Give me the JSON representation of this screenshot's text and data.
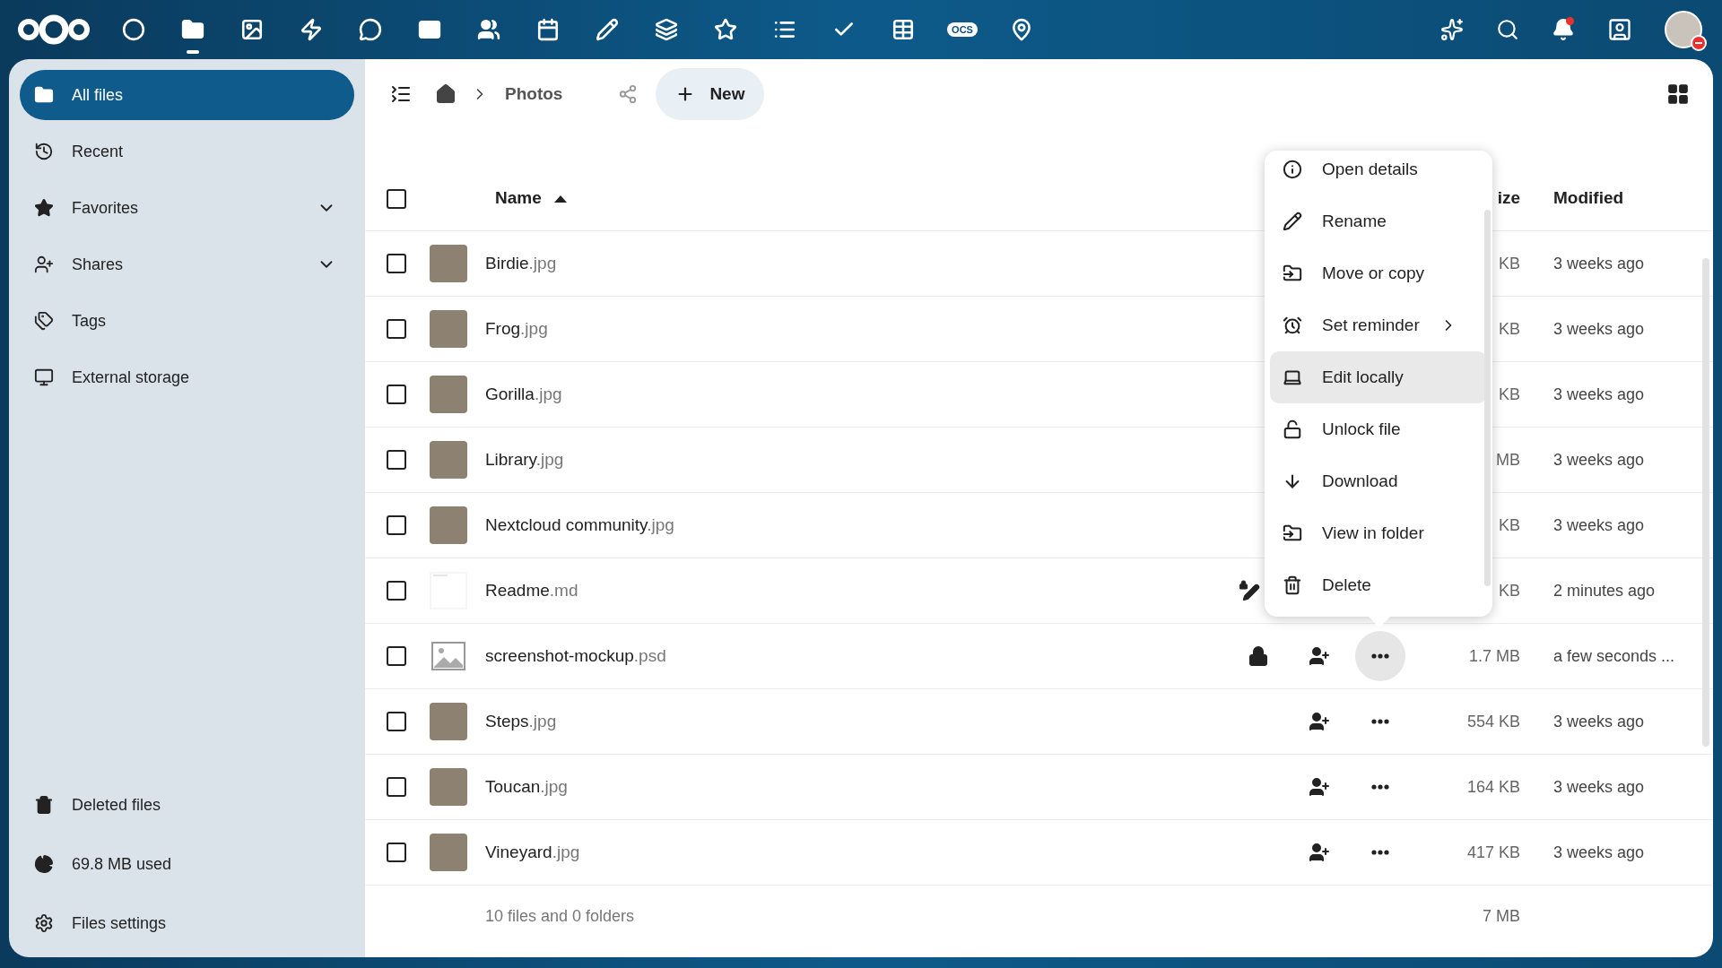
{
  "app_bar": {
    "apps": [
      {
        "selected": false
      },
      {
        "selected": true
      },
      {
        "selected": false
      },
      {
        "selected": false
      },
      {
        "selected": false
      },
      {
        "selected": false
      },
      {
        "selected": false
      },
      {
        "selected": false
      },
      {
        "selected": false
      },
      {
        "selected": false
      },
      {
        "selected": false
      },
      {
        "selected": false
      },
      {
        "selected": false
      },
      {
        "selected": false
      },
      {
        "selected": false,
        "label": "OCS"
      },
      {
        "selected": false
      }
    ],
    "notifications_unread": true,
    "do_not_disturb": true
  },
  "sidebar": {
    "nav": [
      {
        "label": "All files",
        "selected": true
      },
      {
        "label": "Recent",
        "selected": false
      },
      {
        "label": "Favorites",
        "selected": false,
        "expanded": false
      },
      {
        "label": "Shares",
        "selected": false,
        "expanded": false
      },
      {
        "label": "Tags",
        "selected": false
      },
      {
        "label": "External storage",
        "selected": false
      }
    ],
    "footer": [
      {
        "label": "Deleted files"
      },
      {
        "label": "69.8 MB used"
      },
      {
        "label": "Files settings"
      }
    ]
  },
  "toolbar": {
    "breadcrumb": [
      "Photos"
    ],
    "new_button": "New"
  },
  "table": {
    "all_selected": false,
    "columns": [
      {
        "label": "Name",
        "sort_ascending": true
      },
      {
        "label": "ize"
      },
      {
        "label": "Modified"
      }
    ],
    "rows": [
      {
        "name": "Birdie",
        "ext": ".jpg",
        "kind": "photo",
        "selected": false,
        "size": "KB",
        "modified": "3 weeks ago"
      },
      {
        "name": "Frog",
        "ext": ".jpg",
        "kind": "photo",
        "selected": false,
        "size": "KB",
        "modified": "3 weeks ago"
      },
      {
        "name": "Gorilla",
        "ext": ".jpg",
        "kind": "photo",
        "selected": false,
        "size": "KB",
        "modified": "3 weeks ago"
      },
      {
        "name": "Library",
        "ext": ".jpg",
        "kind": "photo",
        "selected": false,
        "size": "MB",
        "modified": "3 weeks ago"
      },
      {
        "name": "Nextcloud community",
        "ext": ".jpg",
        "kind": "photo",
        "selected": false,
        "size": "KB",
        "modified": "3 weeks ago"
      },
      {
        "name": "Readme",
        "ext": ".md",
        "kind": "document",
        "selected": false,
        "edit_locked": true,
        "size": "KB",
        "modified": "2 minutes ago"
      },
      {
        "name": "screenshot-mockup",
        "ext": ".psd",
        "kind": "generic-image",
        "selected": false,
        "locked": true,
        "actions_visible": true,
        "menu_open": true,
        "size": "1.7 MB",
        "modified": "a few seconds ..."
      },
      {
        "name": "Steps",
        "ext": ".jpg",
        "kind": "photo",
        "selected": false,
        "actions_visible": true,
        "menu_open": false,
        "size": "554 KB",
        "modified": "3 weeks ago"
      },
      {
        "name": "Toucan",
        "ext": ".jpg",
        "kind": "photo",
        "selected": false,
        "actions_visible": true,
        "menu_open": false,
        "size": "164 KB",
        "modified": "3 weeks ago"
      },
      {
        "name": "Vineyard",
        "ext": ".jpg",
        "kind": "photo",
        "selected": false,
        "actions_visible": true,
        "menu_open": false,
        "size": "417 KB",
        "modified": "3 weeks ago"
      }
    ],
    "summary": "10 files and 0 folders",
    "total_size": "7 MB"
  },
  "context_menu": {
    "items": [
      {
        "label": "Open details",
        "selected": false
      },
      {
        "label": "Rename",
        "selected": false
      },
      {
        "label": "Move or copy",
        "selected": false
      },
      {
        "label": "Set reminder",
        "selected": false,
        "submenu": true
      },
      {
        "label": "Edit locally",
        "selected": true
      },
      {
        "label": "Unlock file",
        "selected": false
      },
      {
        "label": "Download",
        "selected": false
      },
      {
        "label": "View in folder",
        "selected": false
      },
      {
        "label": "Delete",
        "selected": false
      }
    ]
  }
}
